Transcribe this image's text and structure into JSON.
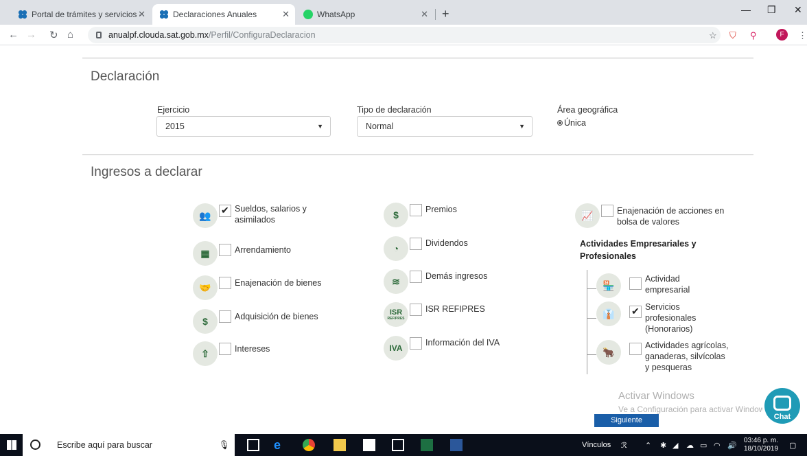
{
  "browser": {
    "tabs": [
      {
        "title": "Portal de trámites y servicios - SA",
        "active": false
      },
      {
        "title": "Declaraciones Anuales",
        "active": true
      },
      {
        "title": "WhatsApp",
        "active": false
      }
    ],
    "url_host": "anualpf.clouda.sat.gob.mx",
    "url_path": "/Perfil/ConfiguraDeclaracion",
    "profile_initial": "F"
  },
  "declaracion": {
    "title": "Declaración",
    "ejercicio_label": "Ejercicio",
    "ejercicio_value": "2015",
    "tipo_label": "Tipo de declaración",
    "tipo_value": "Normal",
    "area_label": "Área geográfica",
    "area_value": "Única"
  },
  "ingresos": {
    "title": "Ingresos a declarar",
    "col1": [
      {
        "label": "Sueldos, salarios y asimilados",
        "checked": true,
        "icon": "people-icon"
      },
      {
        "label": "Arrendamiento",
        "checked": false,
        "icon": "building-icon"
      },
      {
        "label": "Enajenación de bienes",
        "checked": false,
        "icon": "handshake-icon"
      },
      {
        "label": "Adquisición de bienes",
        "checked": false,
        "icon": "money-bag-icon"
      },
      {
        "label": "Intereses",
        "checked": false,
        "icon": "growth-arrow-icon"
      }
    ],
    "col2": [
      {
        "label": "Premios",
        "checked": false,
        "icon": "medal-icon"
      },
      {
        "label": "Dividendos",
        "checked": false,
        "icon": "pie-dollar-icon"
      },
      {
        "label": "Demás ingresos",
        "checked": false,
        "icon": "coins-icon"
      },
      {
        "label": "ISR REFIPRES",
        "checked": false,
        "icon": "isr-icon",
        "glyph": "ISR",
        "glyph_sub": "REFIPRES"
      },
      {
        "label": "Información del IVA",
        "checked": false,
        "icon": "iva-icon",
        "glyph": "IVA"
      }
    ],
    "col3_top": {
      "label": "Enajenación de acciones en bolsa de valores",
      "checked": false,
      "icon": "stock-chart-icon"
    },
    "actividades_title": "Actividades Empresariales y Profesionales",
    "actividades": [
      {
        "label": "Actividad empresarial",
        "checked": false,
        "icon": "store-icon"
      },
      {
        "label": "Servicios profesionales (Honorarios)",
        "checked": true,
        "icon": "professional-icon"
      },
      {
        "label": "Actividades agrícolas, ganaderas, silvícolas y pesqueras",
        "checked": false,
        "icon": "bull-icon"
      }
    ]
  },
  "watermark": {
    "title": "Activar Windows",
    "subtitle": "Ve a Configuración para activar Windows."
  },
  "siguiente_label": "Siguiente",
  "chat_label": "Chat",
  "taskbar": {
    "search_placeholder": "Escribe aquí para buscar",
    "vinculos": "Vínculos",
    "time": "03:46 p. m.",
    "date": "18/10/2019"
  }
}
